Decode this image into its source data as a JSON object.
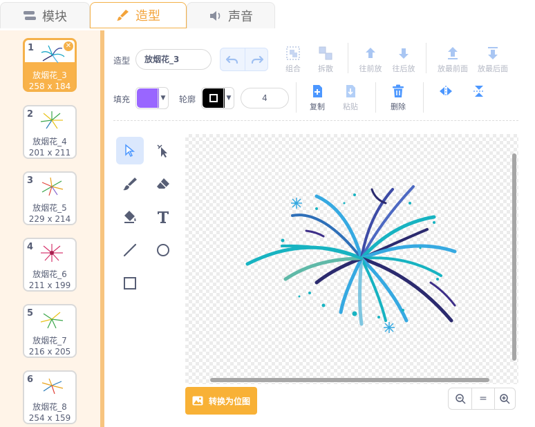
{
  "tabs": [
    {
      "label": "模块",
      "icon": "code-blocks-icon"
    },
    {
      "label": "造型",
      "icon": "paintbrush-icon"
    },
    {
      "label": "声音",
      "icon": "speaker-icon"
    }
  ],
  "colors": {
    "accent": "#f3a33a",
    "fill": "#9966ff",
    "stroke": "#000000",
    "selected_tool_bg": "#dbe8fd"
  },
  "costumes": [
    {
      "num": "1",
      "name": "放烟花_3",
      "size": "258 x 184"
    },
    {
      "num": "2",
      "name": "放烟花_4",
      "size": "201 x 211"
    },
    {
      "num": "3",
      "name": "放烟花_5",
      "size": "229 x 214"
    },
    {
      "num": "4",
      "name": "放烟花_6",
      "size": "211 x 199"
    },
    {
      "num": "5",
      "name": "放烟花_7",
      "size": "216 x 205"
    },
    {
      "num": "6",
      "name": "放烟花_8",
      "size": "254 x 159"
    }
  ],
  "toolbar": {
    "costume_label": "造型",
    "costume_name": "放烟花_3",
    "group": "组合",
    "ungroup": "拆散",
    "forward": "往前放",
    "backward": "往后放",
    "front": "放最前面",
    "back": "放最后面",
    "fill_label": "填充",
    "outline_label": "轮廓",
    "outline_width": "4",
    "copy": "复制",
    "paste": "粘贴",
    "delete": "删除"
  },
  "convert_label": "转换为位图",
  "zoom": {
    "out": "zoom-out-icon",
    "reset": "=",
    "in": "zoom-in-icon"
  }
}
